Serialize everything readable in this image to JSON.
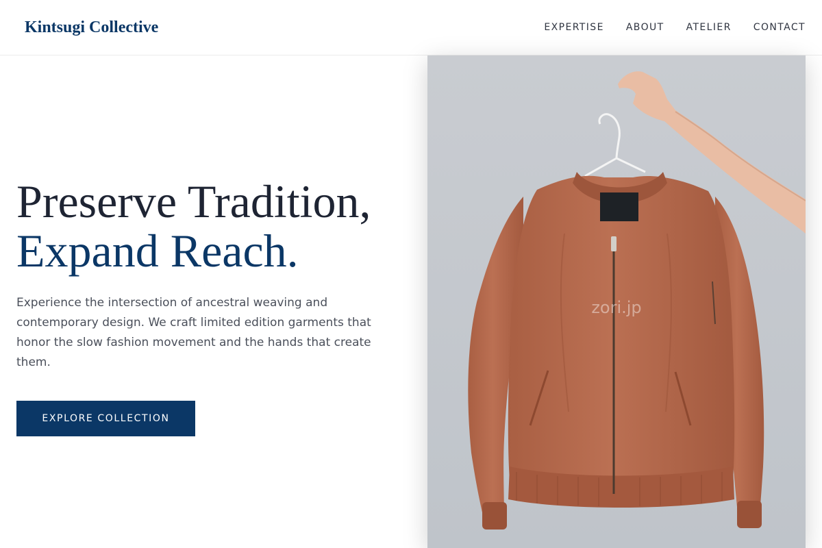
{
  "brand": {
    "name": "Kintsugi Collective"
  },
  "nav": {
    "items": [
      {
        "label": "EXPERTISE"
      },
      {
        "label": "ABOUT"
      },
      {
        "label": "ATELIER"
      },
      {
        "label": "CONTACT"
      }
    ]
  },
  "hero": {
    "title_line1": "Preserve Tradition,",
    "title_line2": "Expand Reach.",
    "description": "Experience the intersection of ancestral weaving and contemporary design. We craft limited edition garments that honor the slow fashion movement and the hands that create them.",
    "cta_label": "EXPLORE COLLECTION",
    "image": {
      "alt": "Terracotta bomber jacket held up on a white hanger",
      "watermark": "zori.jp"
    }
  },
  "colors": {
    "brand_navy": "#0b3766",
    "heading_dark": "#1e2433",
    "body_text": "#4a4f5a",
    "jacket": "#b2674a",
    "photo_background": "#c9cdd2"
  }
}
